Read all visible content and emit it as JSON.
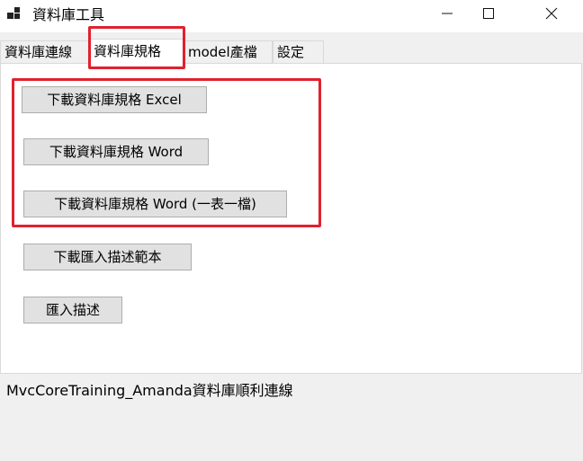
{
  "window": {
    "title": "資料庫工具",
    "icons": {
      "app": "app-icon",
      "minimize": "minimize-icon",
      "maximize": "maximize-icon",
      "close": "close-icon"
    }
  },
  "tabs": [
    {
      "label": "資料庫連線",
      "selected": false
    },
    {
      "label": "資料庫規格",
      "selected": true
    },
    {
      "label": "model產檔",
      "selected": false
    },
    {
      "label": "設定",
      "selected": false
    }
  ],
  "buttons": {
    "download_spec_excel": "下載資料庫規格 Excel",
    "download_spec_word": "下載資料庫規格 Word",
    "download_spec_word_per_table": "下載資料庫規格 Word (一表一檔)",
    "download_import_template": "下載匯入描述範本",
    "import_description": "匯入描述"
  },
  "status": {
    "message": "MvcCoreTraining_Amanda資料庫順利連線"
  },
  "colors": {
    "highlight": "#e0212f",
    "button_bg": "#e1e1e1",
    "panel_bg": "#ffffff",
    "window_bg": "#f0f0f0"
  }
}
